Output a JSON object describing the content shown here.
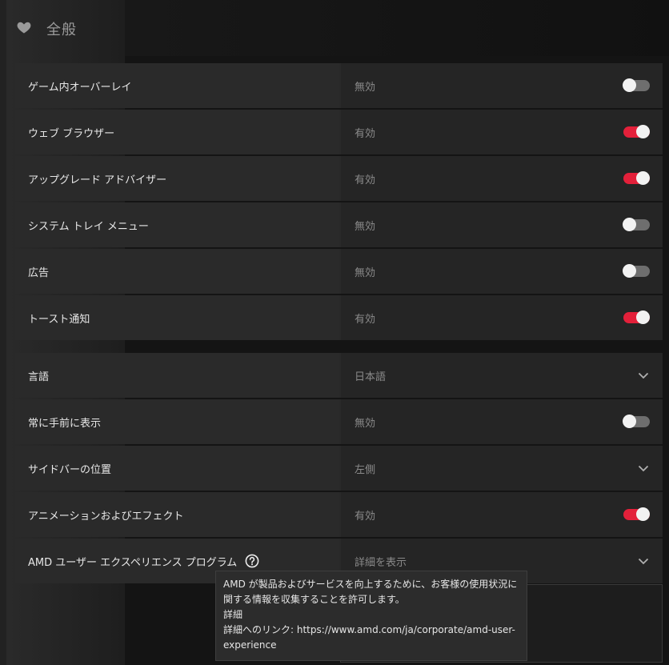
{
  "section": {
    "title": "全般",
    "icon": "heart-icon"
  },
  "group1": [
    {
      "label": "ゲーム内オーバーレイ",
      "value": "無効",
      "control": "toggle",
      "on": false
    },
    {
      "label": "ウェブ ブラウザー",
      "value": "有効",
      "control": "toggle",
      "on": true
    },
    {
      "label": "アップグレード アドバイザー",
      "value": "有効",
      "control": "toggle",
      "on": true
    },
    {
      "label": "システム トレイ メニュー",
      "value": "無効",
      "control": "toggle",
      "on": false
    },
    {
      "label": "広告",
      "value": "無効",
      "control": "toggle",
      "on": false
    },
    {
      "label": "トースト通知",
      "value": "有効",
      "control": "toggle",
      "on": true
    }
  ],
  "group2": [
    {
      "label": "言語",
      "value": "日本語",
      "control": "dropdown"
    },
    {
      "label": "常に手前に表示",
      "value": "無効",
      "control": "toggle",
      "on": false
    },
    {
      "label": "サイドバーの位置",
      "value": "左側",
      "control": "dropdown"
    },
    {
      "label": "アニメーションおよびエフェクト",
      "value": "有効",
      "control": "toggle",
      "on": true
    },
    {
      "label": "AMD ユーザー エクスペリエンス プログラム",
      "value": "詳細を表示",
      "control": "dropdown",
      "help": true
    }
  ],
  "tooltip": {
    "line1": "AMD が製品およびサービスを向上するために、お客様の使用状況に関する情報を収集することを許可します。",
    "line2": "詳細",
    "line3": "詳細へのリンク: https://www.amd.com/ja/corporate/amd-user-experience"
  },
  "colors": {
    "accent": "#e3203a",
    "toggle_off": "#6e6e6e",
    "row_bg": "#2a2a2a"
  }
}
